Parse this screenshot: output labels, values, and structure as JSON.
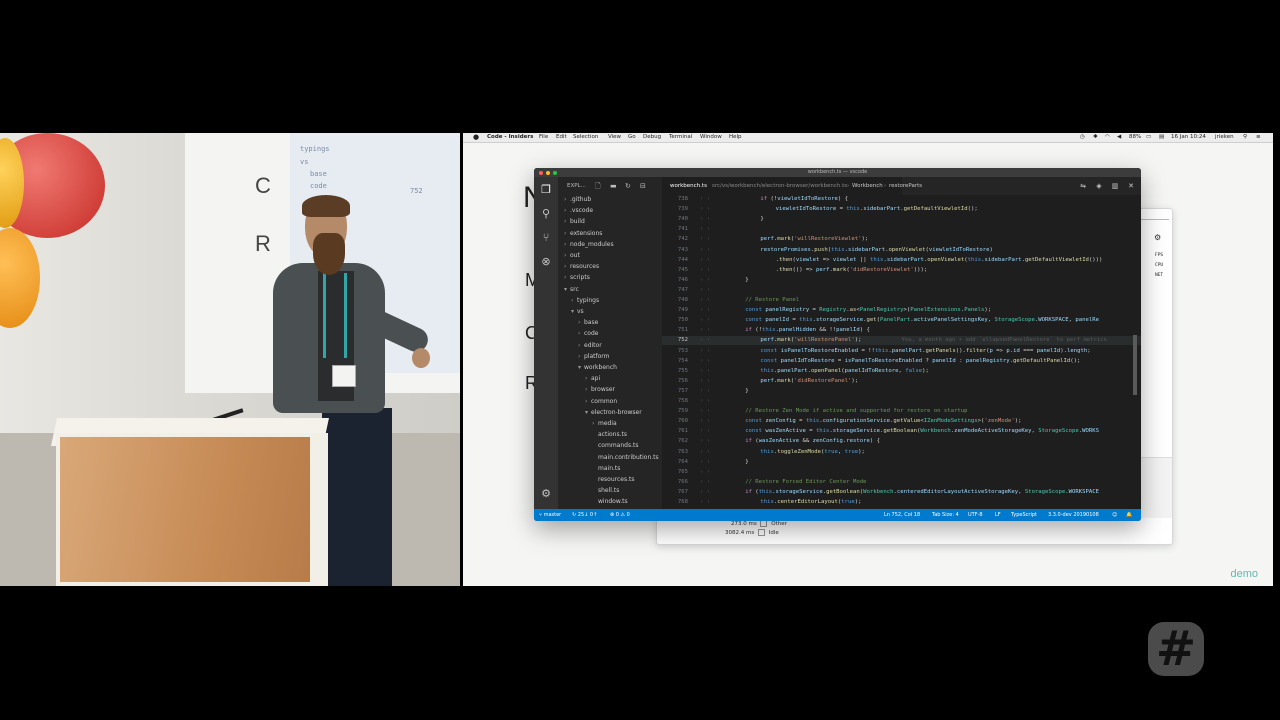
{
  "camera": {
    "screen_lines": [
      "typings",
      "vs",
      "base",
      "code",
      "752"
    ],
    "screen_letters": [
      "C",
      "R"
    ]
  },
  "menubar": {
    "apple": "",
    "app": "Code - Insiders",
    "items": [
      "File",
      "Edit",
      "Selection",
      "View",
      "Go",
      "Debug",
      "Terminal",
      "Window",
      "Help"
    ],
    "battery": "88%",
    "clock": "16 Jan 10:24",
    "user": "jrieken"
  },
  "background_window": {
    "letters": [
      "N",
      "M",
      "C",
      "R"
    ],
    "side_labels": [
      "FPS",
      "CPU",
      "NET"
    ],
    "timings": [
      {
        "value": "273.0 ms",
        "label": "Other"
      },
      {
        "value": "3082.4 ms",
        "label": "Idle"
      }
    ]
  },
  "vscode": {
    "title": "workbench.ts — vscode",
    "explorer_header": "EXPL...",
    "tree": [
      {
        "label": ".github",
        "depth": 0,
        "open": false,
        "folder": true
      },
      {
        "label": ".vscode",
        "depth": 0,
        "open": false,
        "folder": true
      },
      {
        "label": "build",
        "depth": 0,
        "open": false,
        "folder": true
      },
      {
        "label": "extensions",
        "depth": 0,
        "open": false,
        "folder": true
      },
      {
        "label": "node_modules",
        "depth": 0,
        "open": false,
        "folder": true
      },
      {
        "label": "out",
        "depth": 0,
        "open": false,
        "folder": true
      },
      {
        "label": "resources",
        "depth": 0,
        "open": false,
        "folder": true
      },
      {
        "label": "scripts",
        "depth": 0,
        "open": false,
        "folder": true
      },
      {
        "label": "src",
        "depth": 0,
        "open": true,
        "folder": true
      },
      {
        "label": "typings",
        "depth": 1,
        "open": false,
        "folder": true
      },
      {
        "label": "vs",
        "depth": 1,
        "open": true,
        "folder": true
      },
      {
        "label": "base",
        "depth": 2,
        "open": false,
        "folder": true
      },
      {
        "label": "code",
        "depth": 2,
        "open": false,
        "folder": true
      },
      {
        "label": "editor",
        "depth": 2,
        "open": false,
        "folder": true
      },
      {
        "label": "platform",
        "depth": 2,
        "open": false,
        "folder": true
      },
      {
        "label": "workbench",
        "depth": 2,
        "open": true,
        "folder": true
      },
      {
        "label": "api",
        "depth": 3,
        "open": false,
        "folder": true
      },
      {
        "label": "browser",
        "depth": 3,
        "open": false,
        "folder": true
      },
      {
        "label": "common",
        "depth": 3,
        "open": false,
        "folder": true
      },
      {
        "label": "electron-browser",
        "depth": 3,
        "open": true,
        "folder": true
      },
      {
        "label": "media",
        "depth": 4,
        "open": false,
        "folder": true
      },
      {
        "label": "actions.ts",
        "depth": 4,
        "open": false,
        "folder": false
      },
      {
        "label": "commands.ts",
        "depth": 4,
        "open": false,
        "folder": false
      },
      {
        "label": "main.contribution.ts",
        "depth": 4,
        "open": false,
        "folder": false
      },
      {
        "label": "main.ts",
        "depth": 4,
        "open": false,
        "folder": false
      },
      {
        "label": "resources.ts",
        "depth": 4,
        "open": false,
        "folder": false
      },
      {
        "label": "shell.ts",
        "depth": 4,
        "open": false,
        "folder": false
      },
      {
        "label": "window.ts",
        "depth": 4,
        "open": false,
        "folder": false
      }
    ],
    "tab": {
      "file": "workbench.ts",
      "path": "src/vs/workbench/electron-browser/workbench.ts",
      "breadcrumb_1": "Workbench",
      "breadcrumb_2": "restoreParts",
      "sep": "›"
    },
    "active_line": 752,
    "ghost_text": "You, a month ago • add `ellapsedPanelRestore` to perf metrics",
    "lines": [
      {
        "n": 738,
        "indent": 2,
        "text": "if (!viewletIdToRestore) {"
      },
      {
        "n": 739,
        "indent": 3,
        "text": "viewletIdToRestore = this.sidebarPart.getDefaultViewletId();"
      },
      {
        "n": 740,
        "indent": 2,
        "text": "}"
      },
      {
        "n": 741,
        "indent": 0,
        "text": ""
      },
      {
        "n": 742,
        "indent": 2,
        "text": "perf.mark('willRestoreViewlet');"
      },
      {
        "n": 743,
        "indent": 2,
        "text": "restorePromises.push(this.sidebarPart.openViewlet(viewletIdToRestore)"
      },
      {
        "n": 744,
        "indent": 3,
        "text": ".then(viewlet => viewlet || this.sidebarPart.openViewlet(this.sidebarPart.getDefaultViewletId()))"
      },
      {
        "n": 745,
        "indent": 3,
        "text": ".then(() => perf.mark('didRestoreViewlet')));"
      },
      {
        "n": 746,
        "indent": 1,
        "text": "}"
      },
      {
        "n": 747,
        "indent": 0,
        "text": ""
      },
      {
        "n": 748,
        "indent": 1,
        "text": "// Restore Panel"
      },
      {
        "n": 749,
        "indent": 1,
        "text": "const panelRegistry = Registry.as<PanelRegistry>(PanelExtensions.Panels);"
      },
      {
        "n": 750,
        "indent": 1,
        "text": "const panelId = this.storageService.get(PanelPart.activePanelSettingsKey, StorageScope.WORKSPACE, panelRe"
      },
      {
        "n": 751,
        "indent": 1,
        "text": "if (!this.panelHidden && !!panelId) {"
      },
      {
        "n": 752,
        "indent": 2,
        "text": "perf.mark('willRestorePanel');"
      },
      {
        "n": 753,
        "indent": 2,
        "text": "const isPanelToRestoreEnabled = !!this.panelPart.getPanels().filter(p => p.id === panelId).length;"
      },
      {
        "n": 754,
        "indent": 2,
        "text": "const panelIdToRestore = isPanelToRestoreEnabled ? panelId : panelRegistry.getDefaultPanelId();"
      },
      {
        "n": 755,
        "indent": 2,
        "text": "this.panelPart.openPanel(panelIdToRestore, false);"
      },
      {
        "n": 756,
        "indent": 2,
        "text": "perf.mark('didRestorePanel');"
      },
      {
        "n": 757,
        "indent": 1,
        "text": "}"
      },
      {
        "n": 758,
        "indent": 0,
        "text": ""
      },
      {
        "n": 759,
        "indent": 1,
        "text": "// Restore Zen Mode if active and supported for restore on startup"
      },
      {
        "n": 760,
        "indent": 1,
        "text": "const zenConfig = this.configurationService.getValue<IZenModeSettings>('zenMode');"
      },
      {
        "n": 761,
        "indent": 1,
        "text": "const wasZenActive = this.storageService.getBoolean(Workbench.zenModeActiveStorageKey, StorageScope.WORKS"
      },
      {
        "n": 762,
        "indent": 1,
        "text": "if (wasZenActive && zenConfig.restore) {"
      },
      {
        "n": 763,
        "indent": 2,
        "text": "this.toggleZenMode(true, true);"
      },
      {
        "n": 764,
        "indent": 1,
        "text": "}"
      },
      {
        "n": 765,
        "indent": 0,
        "text": ""
      },
      {
        "n": 766,
        "indent": 1,
        "text": "// Restore Forced Editor Center Mode"
      },
      {
        "n": 767,
        "indent": 1,
        "text": "if (this.storageService.getBoolean(Workbench.centeredEditorLayoutActiveStorageKey, StorageScope.WORKSPACE"
      },
      {
        "n": 768,
        "indent": 2,
        "text": "this.centerEditorLayout(true);"
      }
    ],
    "status": {
      "branch": "master",
      "sync": "25↓ 0↑",
      "problems": "⊗ 0 ⚠ 0",
      "position": "Ln 752, Col 18",
      "tab_size": "Tab Size: 4",
      "encoding": "UTF-8",
      "eol": "LF",
      "language": "TypeScript",
      "version": "3.3.0-dev 20190108"
    }
  },
  "demo_label": "demo",
  "colors": {
    "keyword": "#569cd6",
    "control": "#c586c0",
    "string": "#ce9178",
    "function": "#dcdcaa",
    "variable": "#9cdcfe",
    "type": "#4ec9b0",
    "comment": "#6a9955",
    "statusbar": "#007acc"
  }
}
